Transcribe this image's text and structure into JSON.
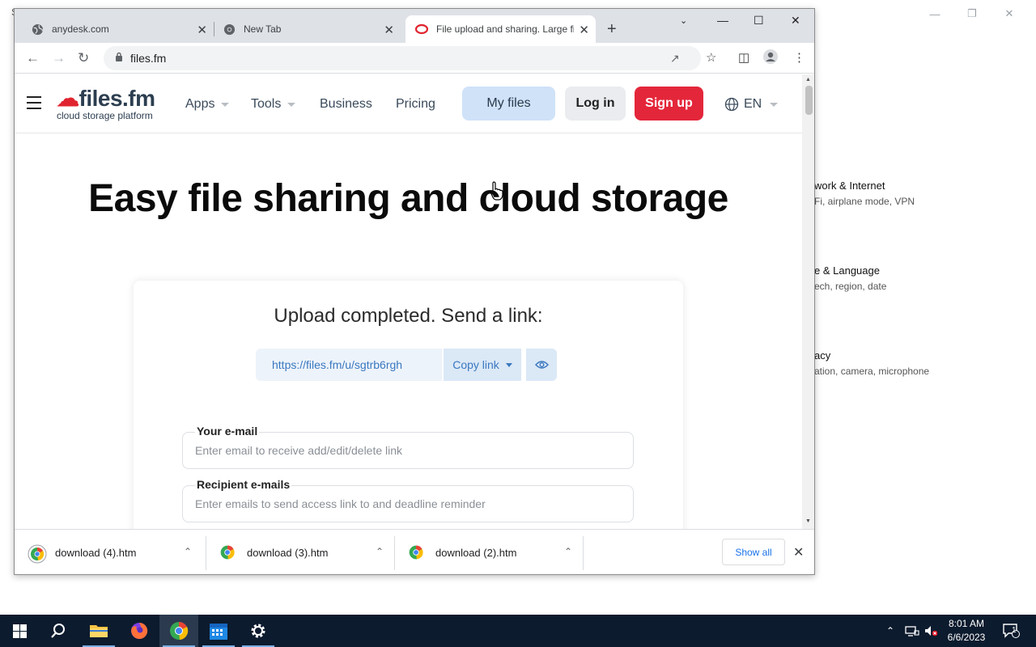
{
  "background_window": {
    "items": [
      {
        "title": "work & Internet",
        "desc": "Fi, airplane mode, VPN"
      },
      {
        "title": "e & Language",
        "desc": "ech, region, date"
      },
      {
        "title": "acy",
        "desc": "ation, camera, microphone"
      }
    ]
  },
  "browser": {
    "tabs": [
      {
        "title": "anydesk.com",
        "favicon": "globe-icon"
      },
      {
        "title": "New Tab",
        "favicon": "chrome-icon"
      },
      {
        "title": "File upload and sharing. Large fil",
        "favicon": "filesfm-icon",
        "active": true
      }
    ],
    "url": "files.fm"
  },
  "site": {
    "logo_text_1": "files",
    "logo_text_2": ".fm",
    "logo_subtitle": "cloud storage platform",
    "nav": {
      "apps": "Apps",
      "tools": "Tools",
      "business": "Business",
      "pricing": "Pricing",
      "my_files": "My files",
      "login": "Log in",
      "signup": "Sign up",
      "lang": "EN"
    },
    "hero_title": "Easy file sharing and cloud storage",
    "upload": {
      "title": "Upload completed. Send a link:",
      "link": "https://files.fm/u/sgtrb6rgh",
      "copy_label": "Copy link",
      "email_label": "Your e-mail",
      "email_placeholder": "Enter email to receive add/edit/delete link",
      "recipients_label": "Recipient e-mails",
      "recipients_placeholder": "Enter emails to send access link to and deadline reminder"
    }
  },
  "downloads": {
    "items": [
      {
        "name": "download (4).htm"
      },
      {
        "name": "download (3).htm"
      },
      {
        "name": "download (2).htm"
      }
    ],
    "show_all": "Show all"
  },
  "taskbar": {
    "time": "8:01 AM",
    "date": "6/6/2023",
    "notification_count": "1"
  },
  "colors": {
    "brand_red": "#e4263a",
    "my_files_bg": "#cfe2f8",
    "link_blue": "#3a78c0",
    "taskbar": "#0c1b2e"
  }
}
